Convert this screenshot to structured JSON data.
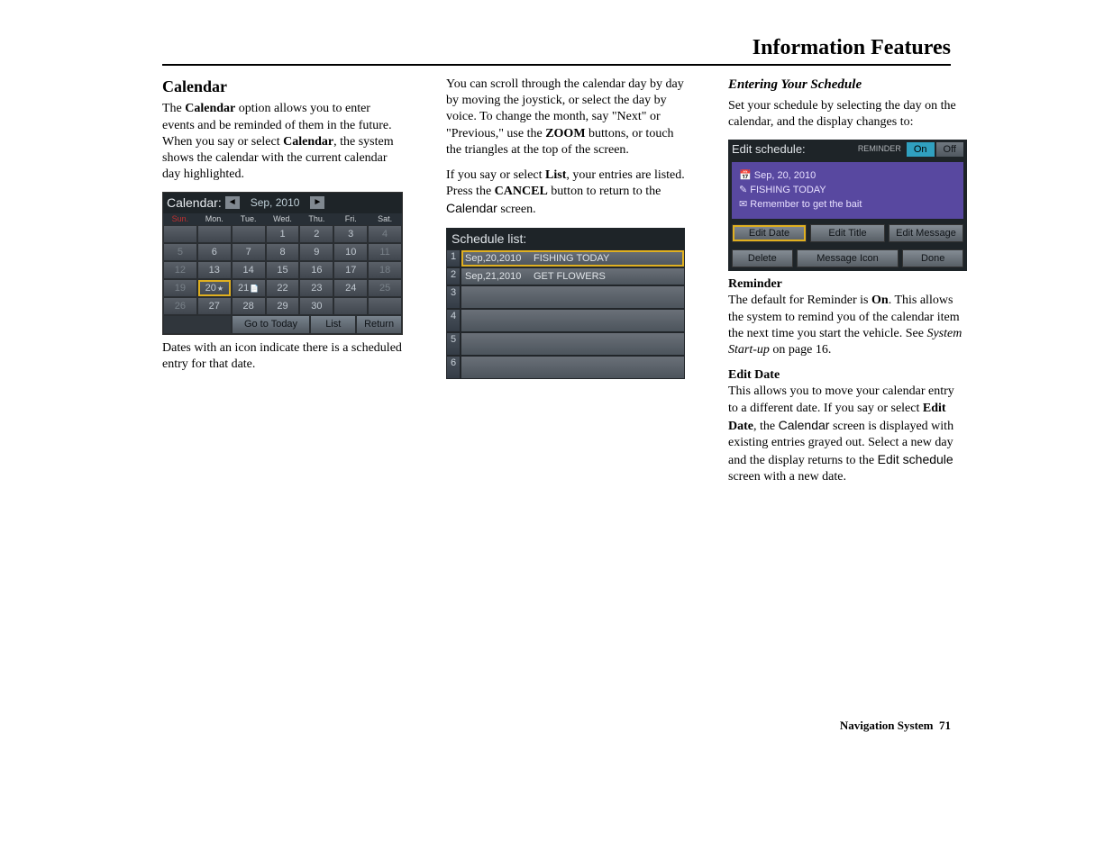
{
  "page": {
    "title": "Information Features",
    "footer_label": "Navigation System",
    "page_number": "71"
  },
  "col1": {
    "heading": "Calendar",
    "p1a": "The ",
    "p1b": "Calendar",
    "p1c": " option allows you to enter events and be reminded of them in the future. When you say or select ",
    "p1d": "Calendar",
    "p1e": ", the system shows the calendar with the current calendar day highlighted.",
    "p2": "Dates with an icon indicate there is a scheduled entry for that date."
  },
  "calendar": {
    "label": "Calendar:",
    "prev": "◄",
    "month": "Sep, 2010",
    "next": "►",
    "days": [
      "Sun.",
      "Mon.",
      "Tue.",
      "Wed.",
      "Thu.",
      "Fri.",
      "Sat."
    ],
    "rows": [
      [
        "",
        "",
        "",
        "1",
        "2",
        "3",
        "4"
      ],
      [
        "5",
        "6",
        "7",
        "8",
        "9",
        "10",
        "11"
      ],
      [
        "12",
        "13",
        "14",
        "15",
        "16",
        "17",
        "18"
      ],
      [
        "19",
        "20",
        "21",
        "22",
        "23",
        "24",
        "25"
      ],
      [
        "26",
        "27",
        "28",
        "29",
        "30",
        "",
        ""
      ]
    ],
    "today_cell": "20",
    "icon_cells": [
      "20",
      "21"
    ],
    "buttons": {
      "go_to_today": "Go to Today",
      "list": "List",
      "return": "Return"
    }
  },
  "col2": {
    "p1a": "You can scroll through the calendar day by day by moving the joystick, or select the day by voice. To change the month, say \"Next\" or \"Previous,\" use the ",
    "p1b": "ZOOM",
    "p1c": " buttons, or touch the triangles at the top of the screen.",
    "p2a": "If you say or select ",
    "p2b": "List",
    "p2c": ", your entries are listed. Press the ",
    "p2d": "CANCEL",
    "p2e": " button to return to the ",
    "p2f": "Calendar",
    "p2g": " screen."
  },
  "schedule_list": {
    "title": "Schedule list:",
    "rows": [
      {
        "n": "1",
        "date": "Sep,20,2010",
        "title": "FISHING TODAY",
        "sel": true
      },
      {
        "n": "2",
        "date": "Sep,21,2010",
        "title": "GET FLOWERS",
        "sel": false
      },
      {
        "n": "3",
        "date": "",
        "title": "",
        "sel": false
      },
      {
        "n": "4",
        "date": "",
        "title": "",
        "sel": false
      },
      {
        "n": "5",
        "date": "",
        "title": "",
        "sel": false
      },
      {
        "n": "6",
        "date": "",
        "title": "",
        "sel": false
      }
    ]
  },
  "col3": {
    "h3": "Entering Your Schedule",
    "p1": "Set your schedule by selecting the day on the calendar, and the display changes to:",
    "h4a": "Reminder",
    "p2a": "The default for Reminder is ",
    "p2b": "On",
    "p2c": ". This allows the system to remind you of the calendar item the next time you start the vehicle. See ",
    "p2d": "System Start-up",
    "p2e": " on page 16.",
    "h4b": "Edit Date",
    "p3a": "This allows you to move your calendar entry to a different date. If you say or select ",
    "p3b": "Edit Date",
    "p3c": ", the ",
    "p3d": "Calendar",
    "p3e": " screen is displayed with existing entries grayed out. Select a new day and the display returns to the ",
    "p3f": "Edit schedule",
    "p3g": " screen with a new date."
  },
  "edit": {
    "title": "Edit schedule:",
    "reminder_label": "REMINDER",
    "on": "On",
    "off": "Off",
    "body_date": "Sep, 20, 2010",
    "body_title": "FISHING TODAY",
    "body_msg": "Remember to get the bait",
    "btns1": [
      "Edit Date",
      "Edit Title",
      "Edit Message"
    ],
    "btns2": [
      "Delete",
      "Message Icon",
      "Done"
    ]
  }
}
